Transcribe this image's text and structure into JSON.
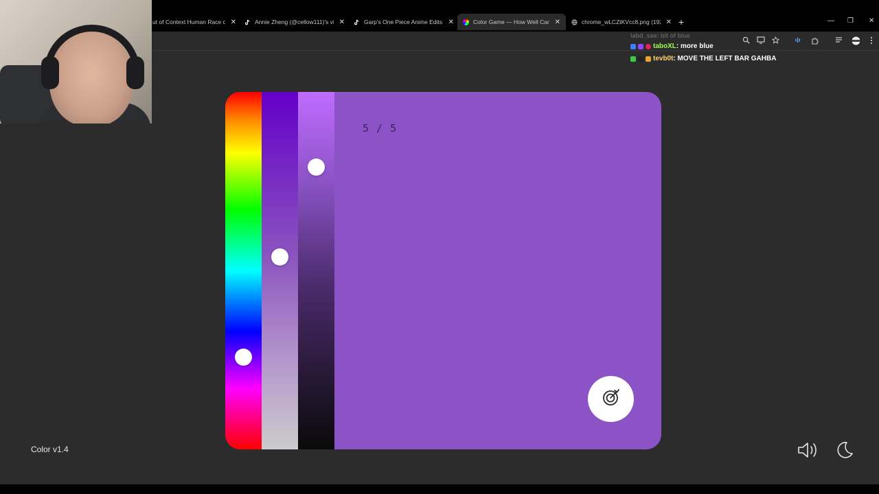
{
  "browser": {
    "tabs": [
      {
        "title": "ut of Context Human Race on",
        "favicon": "generic-icon",
        "active": false
      },
      {
        "title": "Annie Zheng (@cellow111)'s vi",
        "favicon": "tiktok-icon",
        "active": false
      },
      {
        "title": "Garp's One Piece Anime Edits |",
        "favicon": "tiktok-icon",
        "active": false
      },
      {
        "title": "Color Game — How Well Can Y",
        "favicon": "color-wheel-icon",
        "active": true
      },
      {
        "title": "chrome_wLCZtKVcc8.png (1920",
        "favicon": "globe-icon",
        "active": false
      }
    ],
    "close_glyph": "✕",
    "new_tab_glyph": "+",
    "window_controls": {
      "minimize": "—",
      "restore": "❐",
      "close": "✕"
    }
  },
  "chat": {
    "faded_line": "labd_sae: bit of blue",
    "messages": [
      {
        "user": "taboXL",
        "text": ": more blue",
        "user_color": "#9dff4a"
      },
      {
        "user": "tevb0t",
        "text": ": MOVE THE LEFT BAR GAHBA",
        "user_color": "#ffd36b"
      }
    ]
  },
  "game": {
    "counter": "5 / 5",
    "target_color": "#8b53c6",
    "sliders": {
      "hue": {
        "value_fraction": 0.74
      },
      "saturation": {
        "value_fraction": 0.46
      },
      "lightness": {
        "value_fraction": 0.21
      }
    },
    "submit_icon": "target-arrow-icon"
  },
  "footer": {
    "version": "Color v1.4",
    "sound_icon": "speaker-icon",
    "theme_icon": "moon-icon"
  }
}
